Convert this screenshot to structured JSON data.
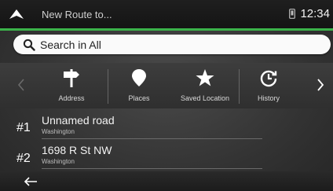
{
  "topbar": {
    "title": "New Route to...",
    "time": "12:34"
  },
  "search": {
    "label": "Search in All"
  },
  "categories": [
    {
      "label": "Address",
      "icon": "signpost-icon"
    },
    {
      "label": "Places",
      "icon": "place-pin-icon"
    },
    {
      "label": "Saved Location",
      "icon": "star-icon"
    },
    {
      "label": "History",
      "icon": "history-icon"
    }
  ],
  "results": [
    {
      "number": "#1",
      "street": "Unnamed road",
      "city": "Washington"
    },
    {
      "number": "#2",
      "street": "1698 R St NW",
      "city": "Washington"
    }
  ],
  "colors": {
    "accent": "#3bb34a",
    "background": "#2b2b2b"
  }
}
